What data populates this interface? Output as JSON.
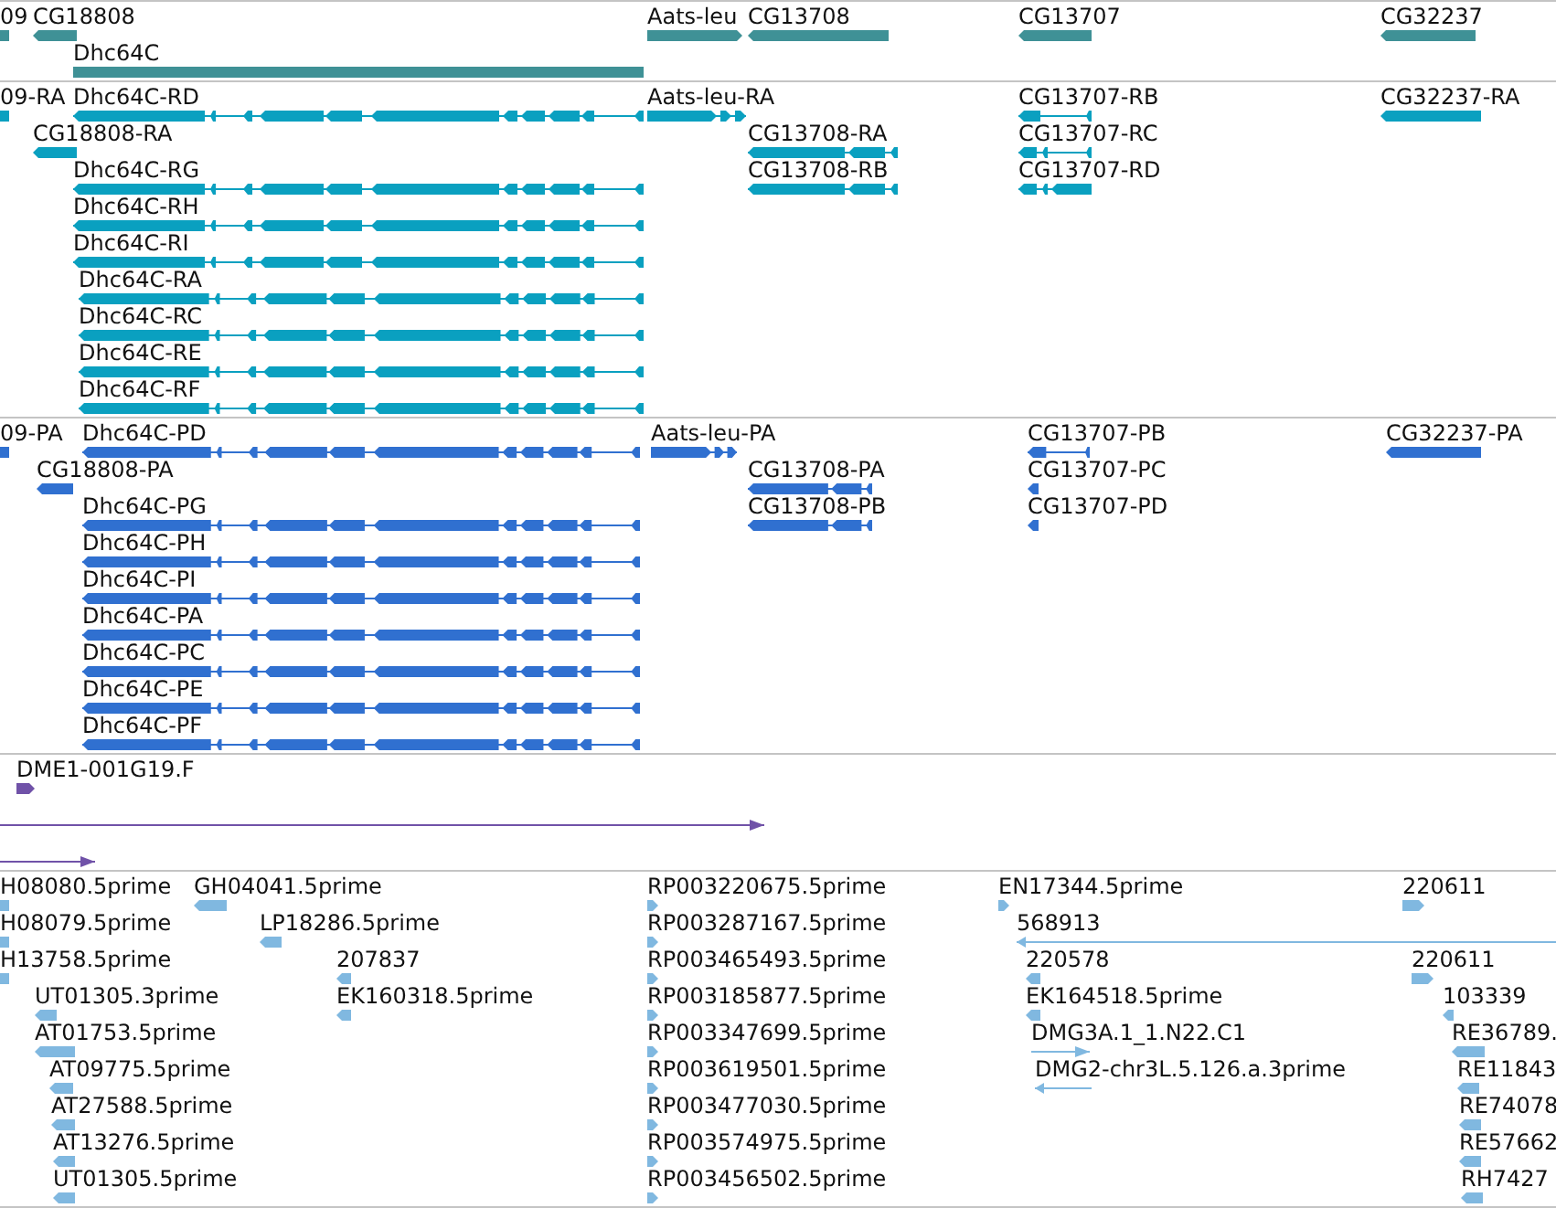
{
  "tracks": [
    {
      "kind": "genes",
      "lanes": [
        {
          "features": [
            {
              "label": "09"
            },
            {
              "label": "CG18808",
              "reverse": true
            },
            {
              "label": "Aats-leu",
              "reverse": false
            },
            {
              "label": "CG13708",
              "reverse": true
            },
            {
              "label": "CG13707",
              "reverse": true
            },
            {
              "label": "CG32237",
              "reverse": true
            }
          ]
        },
        {
          "features": [
            {
              "label": "Dhc64C"
            }
          ]
        }
      ]
    },
    {
      "kind": "transcripts",
      "lanes": [
        {
          "features": [
            {
              "label": "09-RA"
            },
            {
              "label": "Dhc64C-RD",
              "reverse": true
            },
            {
              "label": "Aats-leu-RA",
              "reverse": false
            },
            {
              "label": "CG13707-RB",
              "reverse": true
            },
            {
              "label": "CG32237-RA",
              "reverse": true
            }
          ]
        },
        {
          "features": [
            {
              "label": "CG18808-RA",
              "reverse": true
            },
            {
              "label": "CG13708-RA",
              "reverse": true
            },
            {
              "label": "CG13707-RC",
              "reverse": true
            }
          ]
        },
        {
          "features": [
            {
              "label": "Dhc64C-RG",
              "reverse": true
            },
            {
              "label": "CG13708-RB",
              "reverse": true
            },
            {
              "label": "CG13707-RD",
              "reverse": true
            }
          ]
        },
        {
          "features": [
            {
              "label": "Dhc64C-RH",
              "reverse": true
            }
          ]
        },
        {
          "features": [
            {
              "label": "Dhc64C-RI",
              "reverse": true
            }
          ]
        },
        {
          "features": [
            {
              "label": "Dhc64C-RA",
              "reverse": true
            }
          ]
        },
        {
          "features": [
            {
              "label": "Dhc64C-RC",
              "reverse": true
            }
          ]
        },
        {
          "features": [
            {
              "label": "Dhc64C-RE",
              "reverse": true
            }
          ]
        },
        {
          "features": [
            {
              "label": "Dhc64C-RF",
              "reverse": true
            }
          ]
        }
      ]
    },
    {
      "kind": "proteins",
      "lanes": [
        {
          "features": [
            {
              "label": "09-PA"
            },
            {
              "label": "Dhc64C-PD",
              "reverse": true
            },
            {
              "label": "Aats-leu-PA",
              "reverse": false
            },
            {
              "label": "CG13707-PB",
              "reverse": true
            },
            {
              "label": "CG32237-PA",
              "reverse": true
            }
          ]
        },
        {
          "features": [
            {
              "label": "CG18808-PA",
              "reverse": true
            },
            {
              "label": "CG13708-PA",
              "reverse": true
            },
            {
              "label": "CG13707-PC",
              "reverse": true
            }
          ]
        },
        {
          "features": [
            {
              "label": "Dhc64C-PG",
              "reverse": true
            },
            {
              "label": "CG13708-PB",
              "reverse": true
            },
            {
              "label": "CG13707-PD",
              "reverse": true
            }
          ]
        },
        {
          "features": [
            {
              "label": "Dhc64C-PH",
              "reverse": true
            }
          ]
        },
        {
          "features": [
            {
              "label": "Dhc64C-PI",
              "reverse": true
            }
          ]
        },
        {
          "features": [
            {
              "label": "Dhc64C-PA",
              "reverse": true
            }
          ]
        },
        {
          "features": [
            {
              "label": "Dhc64C-PC",
              "reverse": true
            }
          ]
        },
        {
          "features": [
            {
              "label": "Dhc64C-PE",
              "reverse": true
            }
          ]
        },
        {
          "features": [
            {
              "label": "Dhc64C-PF",
              "reverse": true
            }
          ]
        }
      ]
    },
    {
      "kind": "clones",
      "lanes": [
        {
          "features": [
            {
              "label": "DME1-001G19.F",
              "reverse": false
            }
          ]
        },
        {
          "features": [
            {
              "reverse": false
            }
          ]
        },
        {
          "features": [
            {
              "reverse": false
            }
          ]
        }
      ]
    },
    {
      "kind": "ests",
      "lanes": [
        {
          "features": [
            {
              "label": "H08080.5prime"
            },
            {
              "label": "GH04041.5prime",
              "reverse": true
            },
            {
              "label": "RP003220675.5prime",
              "reverse": false
            },
            {
              "label": "EN17344.5prime",
              "reverse": false
            },
            {
              "label": "220611",
              "reverse": false
            }
          ]
        },
        {
          "features": [
            {
              "label": "H08079.5prime"
            },
            {
              "label": "LP18286.5prime",
              "reverse": true
            },
            {
              "label": "RP003287167.5prime",
              "reverse": false
            },
            {
              "label": "568913",
              "reverse": true
            }
          ]
        },
        {
          "features": [
            {
              "label": "H13758.5prime"
            },
            {
              "label": "207837",
              "reverse": true
            },
            {
              "label": "RP003465493.5prime",
              "reverse": false
            },
            {
              "label": "220578",
              "reverse": true
            },
            {
              "label": "220611",
              "reverse": false
            }
          ]
        },
        {
          "features": [
            {
              "label": "UT01305.3prime",
              "reverse": true
            },
            {
              "label": "EK160318.5prime",
              "reverse": true
            },
            {
              "label": "RP003185877.5prime",
              "reverse": false
            },
            {
              "label": "EK164518.5prime",
              "reverse": true
            },
            {
              "label": "103339",
              "reverse": true
            }
          ]
        },
        {
          "features": [
            {
              "label": "AT01753.5prime",
              "reverse": true
            },
            {
              "label": "RP003347699.5prime",
              "reverse": false
            },
            {
              "label": "DMG3A.1_1.N22.C1",
              "reverse": false
            },
            {
              "label": "RE36789.",
              "reverse": true
            }
          ]
        },
        {
          "features": [
            {
              "label": "AT09775.5prime",
              "reverse": true
            },
            {
              "label": "RP003619501.5prime",
              "reverse": false
            },
            {
              "label": "DMG2-chr3L.5.126.a.3prime",
              "reverse": true
            },
            {
              "label": "RE11843",
              "reverse": true
            }
          ]
        },
        {
          "features": [
            {
              "label": "AT27588.5prime",
              "reverse": true
            },
            {
              "label": "RP003477030.5prime",
              "reverse": false
            },
            {
              "label": "RE74078",
              "reverse": true
            }
          ]
        },
        {
          "features": [
            {
              "label": "AT13276.5prime",
              "reverse": true
            },
            {
              "label": "RP003574975.5prime",
              "reverse": false
            },
            {
              "label": "RE57662",
              "reverse": true
            }
          ]
        },
        {
          "features": [
            {
              "label": "UT01305.5prime",
              "reverse": true
            },
            {
              "label": "RP003456502.5prime",
              "reverse": false
            },
            {
              "label": "RH7427",
              "reverse": true
            }
          ]
        }
      ]
    }
  ]
}
